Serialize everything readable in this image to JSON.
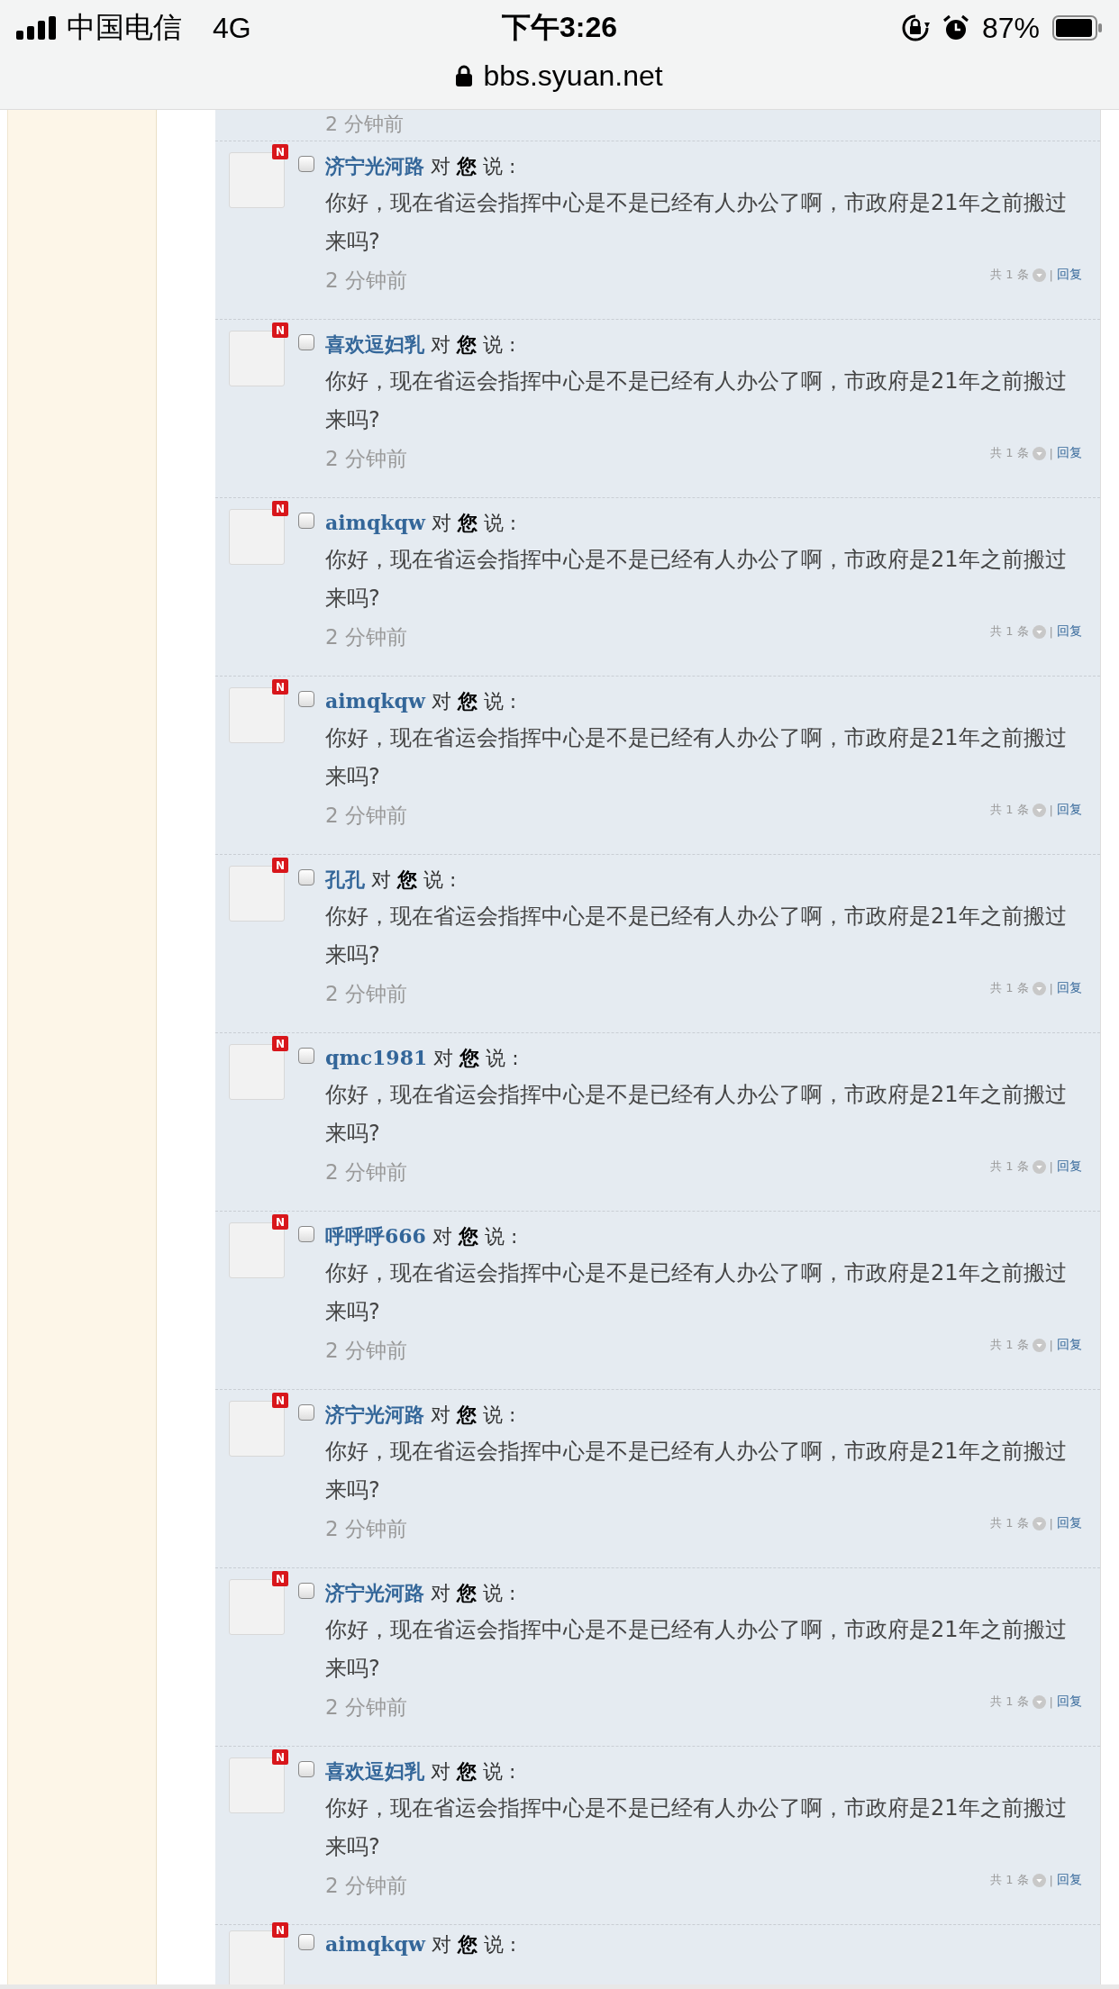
{
  "status_bar": {
    "carrier": "中国电信",
    "network": "4G",
    "time": "下午3:26",
    "battery": "87%",
    "url": "bbs.syuan.net"
  },
  "cut_time": "2 分钟前",
  "messages": [
    {
      "user": "济宁光河路",
      "to": "对",
      "you": "您",
      "said": "说 :",
      "badge": "N",
      "checked": false,
      "text": "你好，现在省运会指挥中心是不是已经有人办公了啊，市政府是21年之前搬过来吗?",
      "time": "2 分钟前",
      "count": "共 1 条",
      "separator": "|",
      "reply": "回复"
    },
    {
      "user": "喜欢逗妇乳",
      "to": "对",
      "you": "您",
      "said": "说 :",
      "badge": "N",
      "checked": false,
      "text": "你好，现在省运会指挥中心是不是已经有人办公了啊，市政府是21年之前搬过来吗?",
      "time": "2 分钟前",
      "count": "共 1 条",
      "separator": "|",
      "reply": "回复"
    },
    {
      "user": "aimqkqw",
      "to": "对",
      "you": "您",
      "said": "说 :",
      "badge": "N",
      "checked": false,
      "text": "你好，现在省运会指挥中心是不是已经有人办公了啊，市政府是21年之前搬过来吗?",
      "time": "2 分钟前",
      "count": "共 1 条",
      "separator": "|",
      "reply": "回复"
    },
    {
      "user": "aimqkqw",
      "to": "对",
      "you": "您",
      "said": "说 :",
      "badge": "N",
      "checked": false,
      "text": "你好，现在省运会指挥中心是不是已经有人办公了啊，市政府是21年之前搬过来吗?",
      "time": "2 分钟前",
      "count": "共 1 条",
      "separator": "|",
      "reply": "回复"
    },
    {
      "user": "孔孔",
      "to": "对",
      "you": "您",
      "said": "说 :",
      "badge": "N",
      "checked": false,
      "text": "你好，现在省运会指挥中心是不是已经有人办公了啊，市政府是21年之前搬过来吗?",
      "time": "2 分钟前",
      "count": "共 1 条",
      "separator": "|",
      "reply": "回复"
    },
    {
      "user": "qmc1981",
      "to": "对",
      "you": "您",
      "said": "说 :",
      "badge": "N",
      "checked": false,
      "text": "你好，现在省运会指挥中心是不是已经有人办公了啊，市政府是21年之前搬过来吗?",
      "time": "2 分钟前",
      "count": "共 1 条",
      "separator": "|",
      "reply": "回复"
    },
    {
      "user": "呼呼呼666",
      "to": "对",
      "you": "您",
      "said": "说 :",
      "badge": "N",
      "checked": false,
      "text": "你好，现在省运会指挥中心是不是已经有人办公了啊，市政府是21年之前搬过来吗?",
      "time": "2 分钟前",
      "count": "共 1 条",
      "separator": "|",
      "reply": "回复"
    },
    {
      "user": "济宁光河路",
      "to": "对",
      "you": "您",
      "said": "说 :",
      "badge": "N",
      "checked": false,
      "text": "你好，现在省运会指挥中心是不是已经有人办公了啊，市政府是21年之前搬过来吗?",
      "time": "2 分钟前",
      "count": "共 1 条",
      "separator": "|",
      "reply": "回复"
    },
    {
      "user": "济宁光河路",
      "to": "对",
      "you": "您",
      "said": "说 :",
      "badge": "N",
      "checked": false,
      "text": "你好，现在省运会指挥中心是不是已经有人办公了啊，市政府是21年之前搬过来吗?",
      "time": "2 分钟前",
      "count": "共 1 条",
      "separator": "|",
      "reply": "回复"
    },
    {
      "user": "喜欢逗妇乳",
      "to": "对",
      "you": "您",
      "said": "说 :",
      "badge": "N",
      "checked": false,
      "text": "你好，现在省运会指挥中心是不是已经有人办公了啊，市政府是21年之前搬过来吗?",
      "time": "2 分钟前",
      "count": "共 1 条",
      "separator": "|",
      "reply": "回复"
    }
  ],
  "cut_message": {
    "user": "aimqkqw",
    "to": "对",
    "you": "您",
    "said": "说 :",
    "badge": "N",
    "checked": false
  }
}
